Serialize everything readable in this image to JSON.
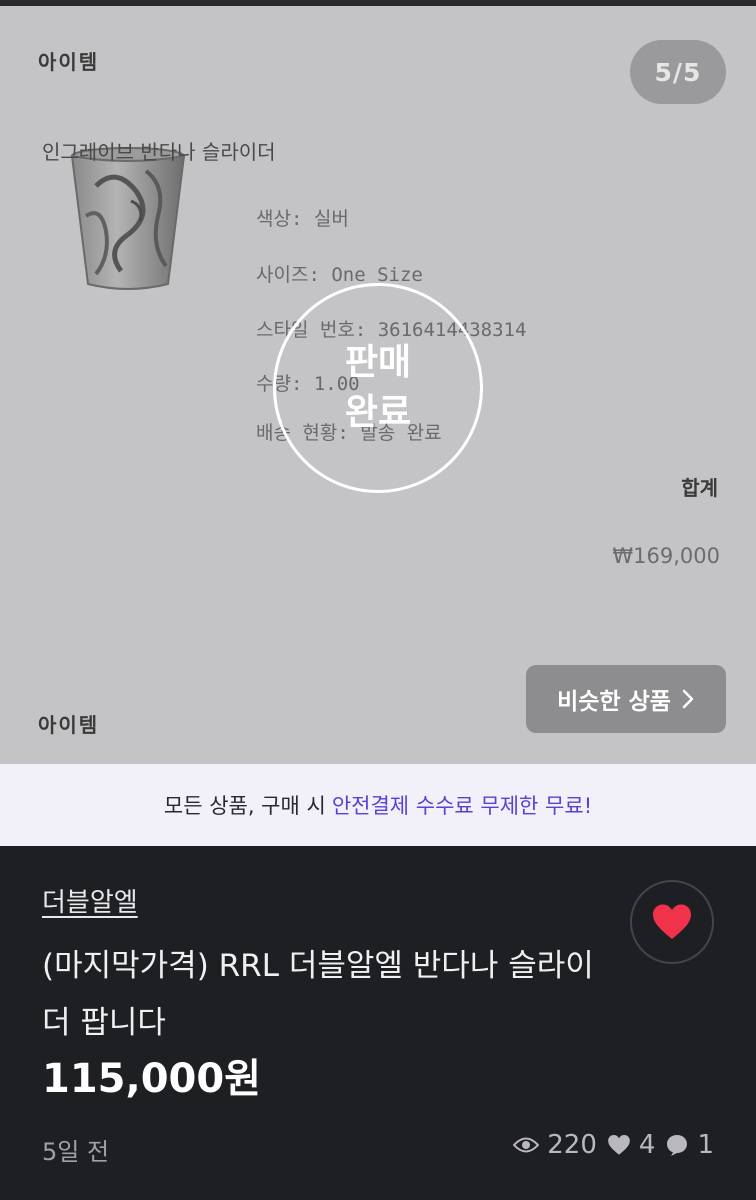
{
  "gallery": {
    "label_top": "아이템",
    "label_bottom": "아이템",
    "counter": "5/5",
    "receipt": {
      "product_name": "인그레이브 반다나 슬라이더",
      "color": "색상: 실버",
      "size": "사이즈: One Size",
      "style_no": "스타일 번호: 3616414438314",
      "quantity": "수량: 1.00",
      "shipping": "배송 현황: 발송 완료",
      "total_label": "합계",
      "total_value": "₩169,000"
    },
    "sold_badge_line1": "판매",
    "sold_badge_line2": "완료",
    "similar_button": "비슷한 상품"
  },
  "promo": {
    "text": "모든 상품, 구매 시",
    "highlight": "안전결제 수수료 무제한 무료!",
    "highlight_color": "#5b3fd6"
  },
  "listing": {
    "seller": "더블알엘",
    "title": "(마지막가격) RRL 더블알엘 반다나 슬라이더 팝니다",
    "price": "115,000원",
    "posted": "5일 전",
    "views": "220",
    "likes": "4",
    "chats": "1",
    "heart_color": "#f0334a",
    "icons": [
      "heart-icon",
      "eye-icon",
      "heart-small-icon",
      "chat-icon",
      "chevron-right-icon"
    ]
  }
}
